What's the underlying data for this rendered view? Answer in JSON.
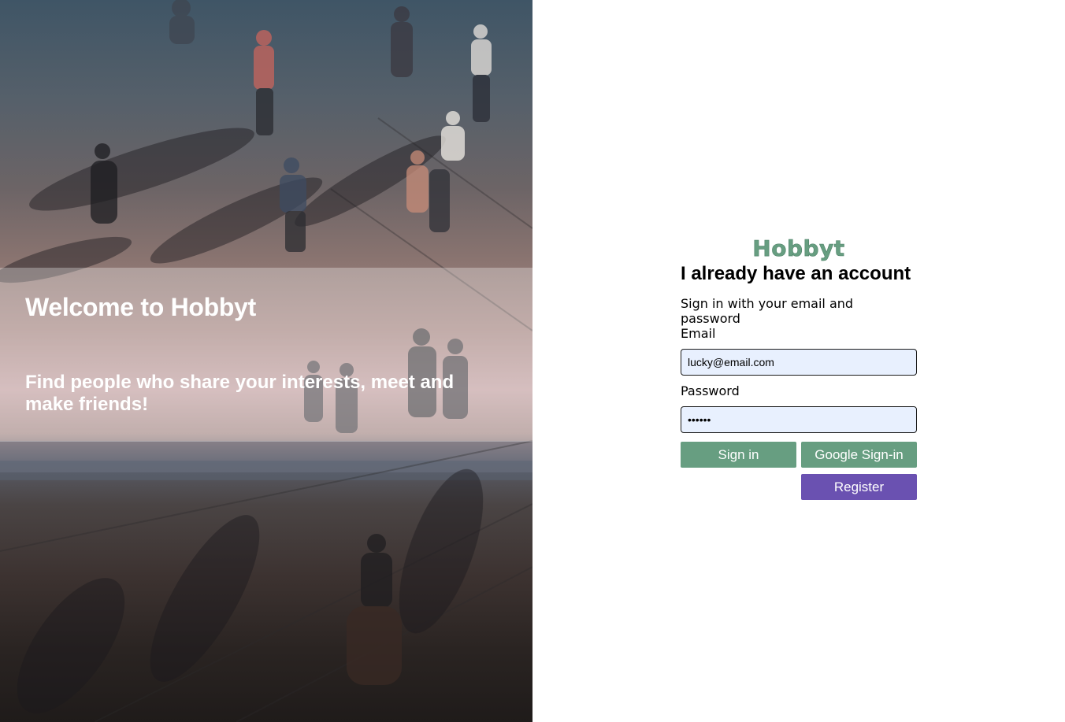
{
  "hero": {
    "title": "Welcome to Hobbyt",
    "subtitle": "Find people who share your interests, meet and make friends!"
  },
  "auth": {
    "logo": "Hobbyt",
    "heading": "I already have an account",
    "subtitle": "Sign in with your email and password",
    "email_label": "Email",
    "email_value": "lucky@email.com",
    "password_label": "Password",
    "password_value": "••••••",
    "sign_in_label": "Sign in",
    "google_label": "Google Sign-in",
    "register_label": "Register"
  },
  "colors": {
    "brand_green": "#679e81",
    "register_purple": "#6a51b1",
    "autofill_blue": "#e8f0fe"
  }
}
